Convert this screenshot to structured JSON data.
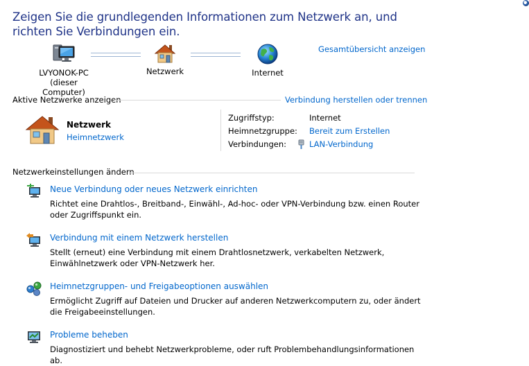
{
  "heading": "Zeigen Sie die grundlegenden Informationen zum Netzwerk an, und richten Sie Verbindungen ein.",
  "map": {
    "computer_name": "LVYONOK-PC",
    "computer_sub": "(dieser Computer)",
    "network_label": "Netzwerk",
    "internet_label": "Internet",
    "full_map_link": "Gesamtübersicht anzeigen"
  },
  "active": {
    "title": "Aktive Netzwerke anzeigen",
    "connect_link": "Verbindung herstellen oder trennen",
    "network_name": "Netzwerk",
    "network_type": "Heimnetzwerk",
    "access_type_label": "Zugriffstyp:",
    "access_type_value": "Internet",
    "homegroup_label": "Heimnetzgruppe:",
    "homegroup_value": "Bereit zum Erstellen",
    "connections_label": "Verbindungen:",
    "connections_value": "LAN-Verbindung"
  },
  "settings": {
    "title": "Netzwerkeinstellungen ändern",
    "tasks": [
      {
        "title": "Neue Verbindung oder neues Netzwerk einrichten",
        "desc": "Richtet eine Drahtlos-, Breitband-, Einwähl-, Ad-hoc- oder VPN-Verbindung bzw. einen Router oder Zugriffspunkt ein."
      },
      {
        "title": "Verbindung mit einem Netzwerk herstellen",
        "desc": "Stellt (erneut) eine Verbindung mit einem Drahtlosnetzwerk, verkabelten Netzwerk, Einwählnetzwerk oder VPN-Netzwerk her."
      },
      {
        "title": "Heimnetzgruppen- und Freigabeoptionen auswählen",
        "desc": "Ermöglicht Zugriff auf Dateien und Drucker auf anderen Netzwerkcomputern zu, oder ändert die Freigabeeinstellungen."
      },
      {
        "title": "Probleme beheben",
        "desc": "Diagnostiziert und behebt Netzwerkprobleme, oder ruft Problembehandlungsinformationen ab."
      }
    ]
  },
  "colors": {
    "heading": "#1e3287",
    "link": "#0066cc"
  }
}
